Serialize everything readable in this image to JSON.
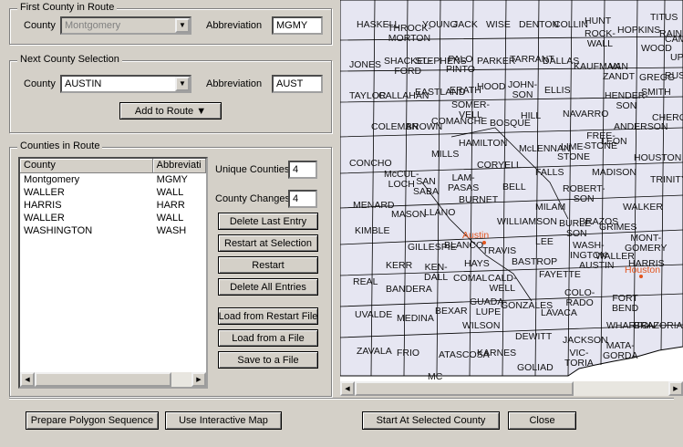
{
  "first_county": {
    "group_title": "First County in Route",
    "county_label": "County",
    "county_value": "Montgomery",
    "abbr_label": "Abbreviation",
    "abbr_value": "MGMY"
  },
  "next_county": {
    "group_title": "Next County Selection",
    "county_label": "County",
    "county_value": "AUSTIN",
    "abbr_label": "Abbreviation",
    "abbr_value": "AUST",
    "add_button": "Add to Route ▼"
  },
  "route": {
    "group_title": "Counties in Route",
    "columns": [
      "County",
      "Abbreviati"
    ],
    "rows": [
      [
        "Montgomery",
        "MGMY"
      ],
      [
        "WALLER",
        "WALL"
      ],
      [
        "HARRIS",
        "HARR"
      ],
      [
        "WALLER",
        "WALL"
      ],
      [
        "WASHINGTON",
        "WASH"
      ]
    ],
    "unique_label": "Unique Counties",
    "unique_value": "4",
    "changes_label": "County Changes",
    "changes_value": "4",
    "buttons": {
      "delete_last": "Delete Last Entry",
      "restart_sel": "Restart at Selection",
      "restart": "Restart",
      "delete_all": "Delete All Entries",
      "load_restart": "Load from Restart File",
      "load_file": "Load from a File",
      "save_file": "Save to a File"
    }
  },
  "bottom": {
    "prepare": "Prepare Polygon Sequence",
    "interactive": "Use Interactive Map",
    "start": "Start At Selected County",
    "close": "Close"
  },
  "map": {
    "counties": [
      "HASKELL",
      "THROCK-\nMORTON",
      "YOUNG",
      "JACK",
      "WISE",
      "DENTON",
      "COLLIN",
      "HUNT",
      "ROCK-\nWALL",
      "HOPKINS",
      "TITUS",
      "CAMP",
      "WOOD",
      "UPSHUR",
      "JONES",
      "SHACKEL-\nFORD",
      "STEPHENS",
      "PALO\nPINTO",
      "PARKER",
      "TARRANT",
      "DALLAS",
      "KAUFMAN",
      "VAN\nZANDT",
      "RAINS",
      "GREGG",
      "SMITH",
      "TAYLOR",
      "CALLAHAN",
      "EASTLAND",
      "ERATH",
      "SOMER-\nVELL",
      "HOOD",
      "JOHN-\nSON",
      "ELLIS",
      "HENDER-\nSON",
      "RUSK",
      "COLEMAN",
      "BROWN",
      "COMANCHE",
      "HAMILTON",
      "BOSQUE",
      "HILL",
      "NAVARRO",
      "FREE-\nSTONE",
      "ANDERSON",
      "CHEROKEE",
      "CONCHO",
      "McCUL-\nLOCH",
      "MILLS",
      "CORYELL",
      "McLENNAN",
      "LIME-\nSTONE",
      "LEON",
      "HOUSTON",
      "MADISON",
      "SAN\nSABA",
      "LAM-\nPASAS",
      "BELL",
      "FALLS",
      "TRINITY",
      "MENARD",
      "MASON",
      "LLANO",
      "BURNET",
      "MILAM",
      "ROBERT-\nSON",
      "WALKER",
      "WILLIAMSON",
      "KIMBLE",
      "GILLESPIE",
      "BLANCO",
      "TRAVIS",
      "LEE",
      "BURLE-\nSON",
      "BRAZOS",
      "GRIMES",
      "MONT-\nGOMERY",
      "WASH-\nINGTON",
      "KERR",
      "KEN-\nDALL",
      "HAYS",
      "BASTROP",
      "FAYETTE",
      "AUSTIN",
      "WALLER",
      "HARRIS",
      "REAL",
      "BANDERA",
      "COMAL",
      "CALD-\nWELL",
      "GUADA-\nLUPE",
      "BEXAR",
      "WILSON",
      "GONZALES",
      "LAVACA",
      "COLO-\nRADO",
      "WHARTON",
      "FORT\nBEND",
      "BRAZORIA",
      "UVALDE",
      "MEDINA",
      "ZAVALA",
      "FRIO",
      "ATASCOSA",
      "KARNES",
      "DEWITT",
      "VIC-\nTORIA",
      "JACKSON",
      "MATA-\nGORDA",
      "GOLIAD",
      "MC"
    ],
    "cities": [
      "Austin",
      "Houston"
    ]
  }
}
